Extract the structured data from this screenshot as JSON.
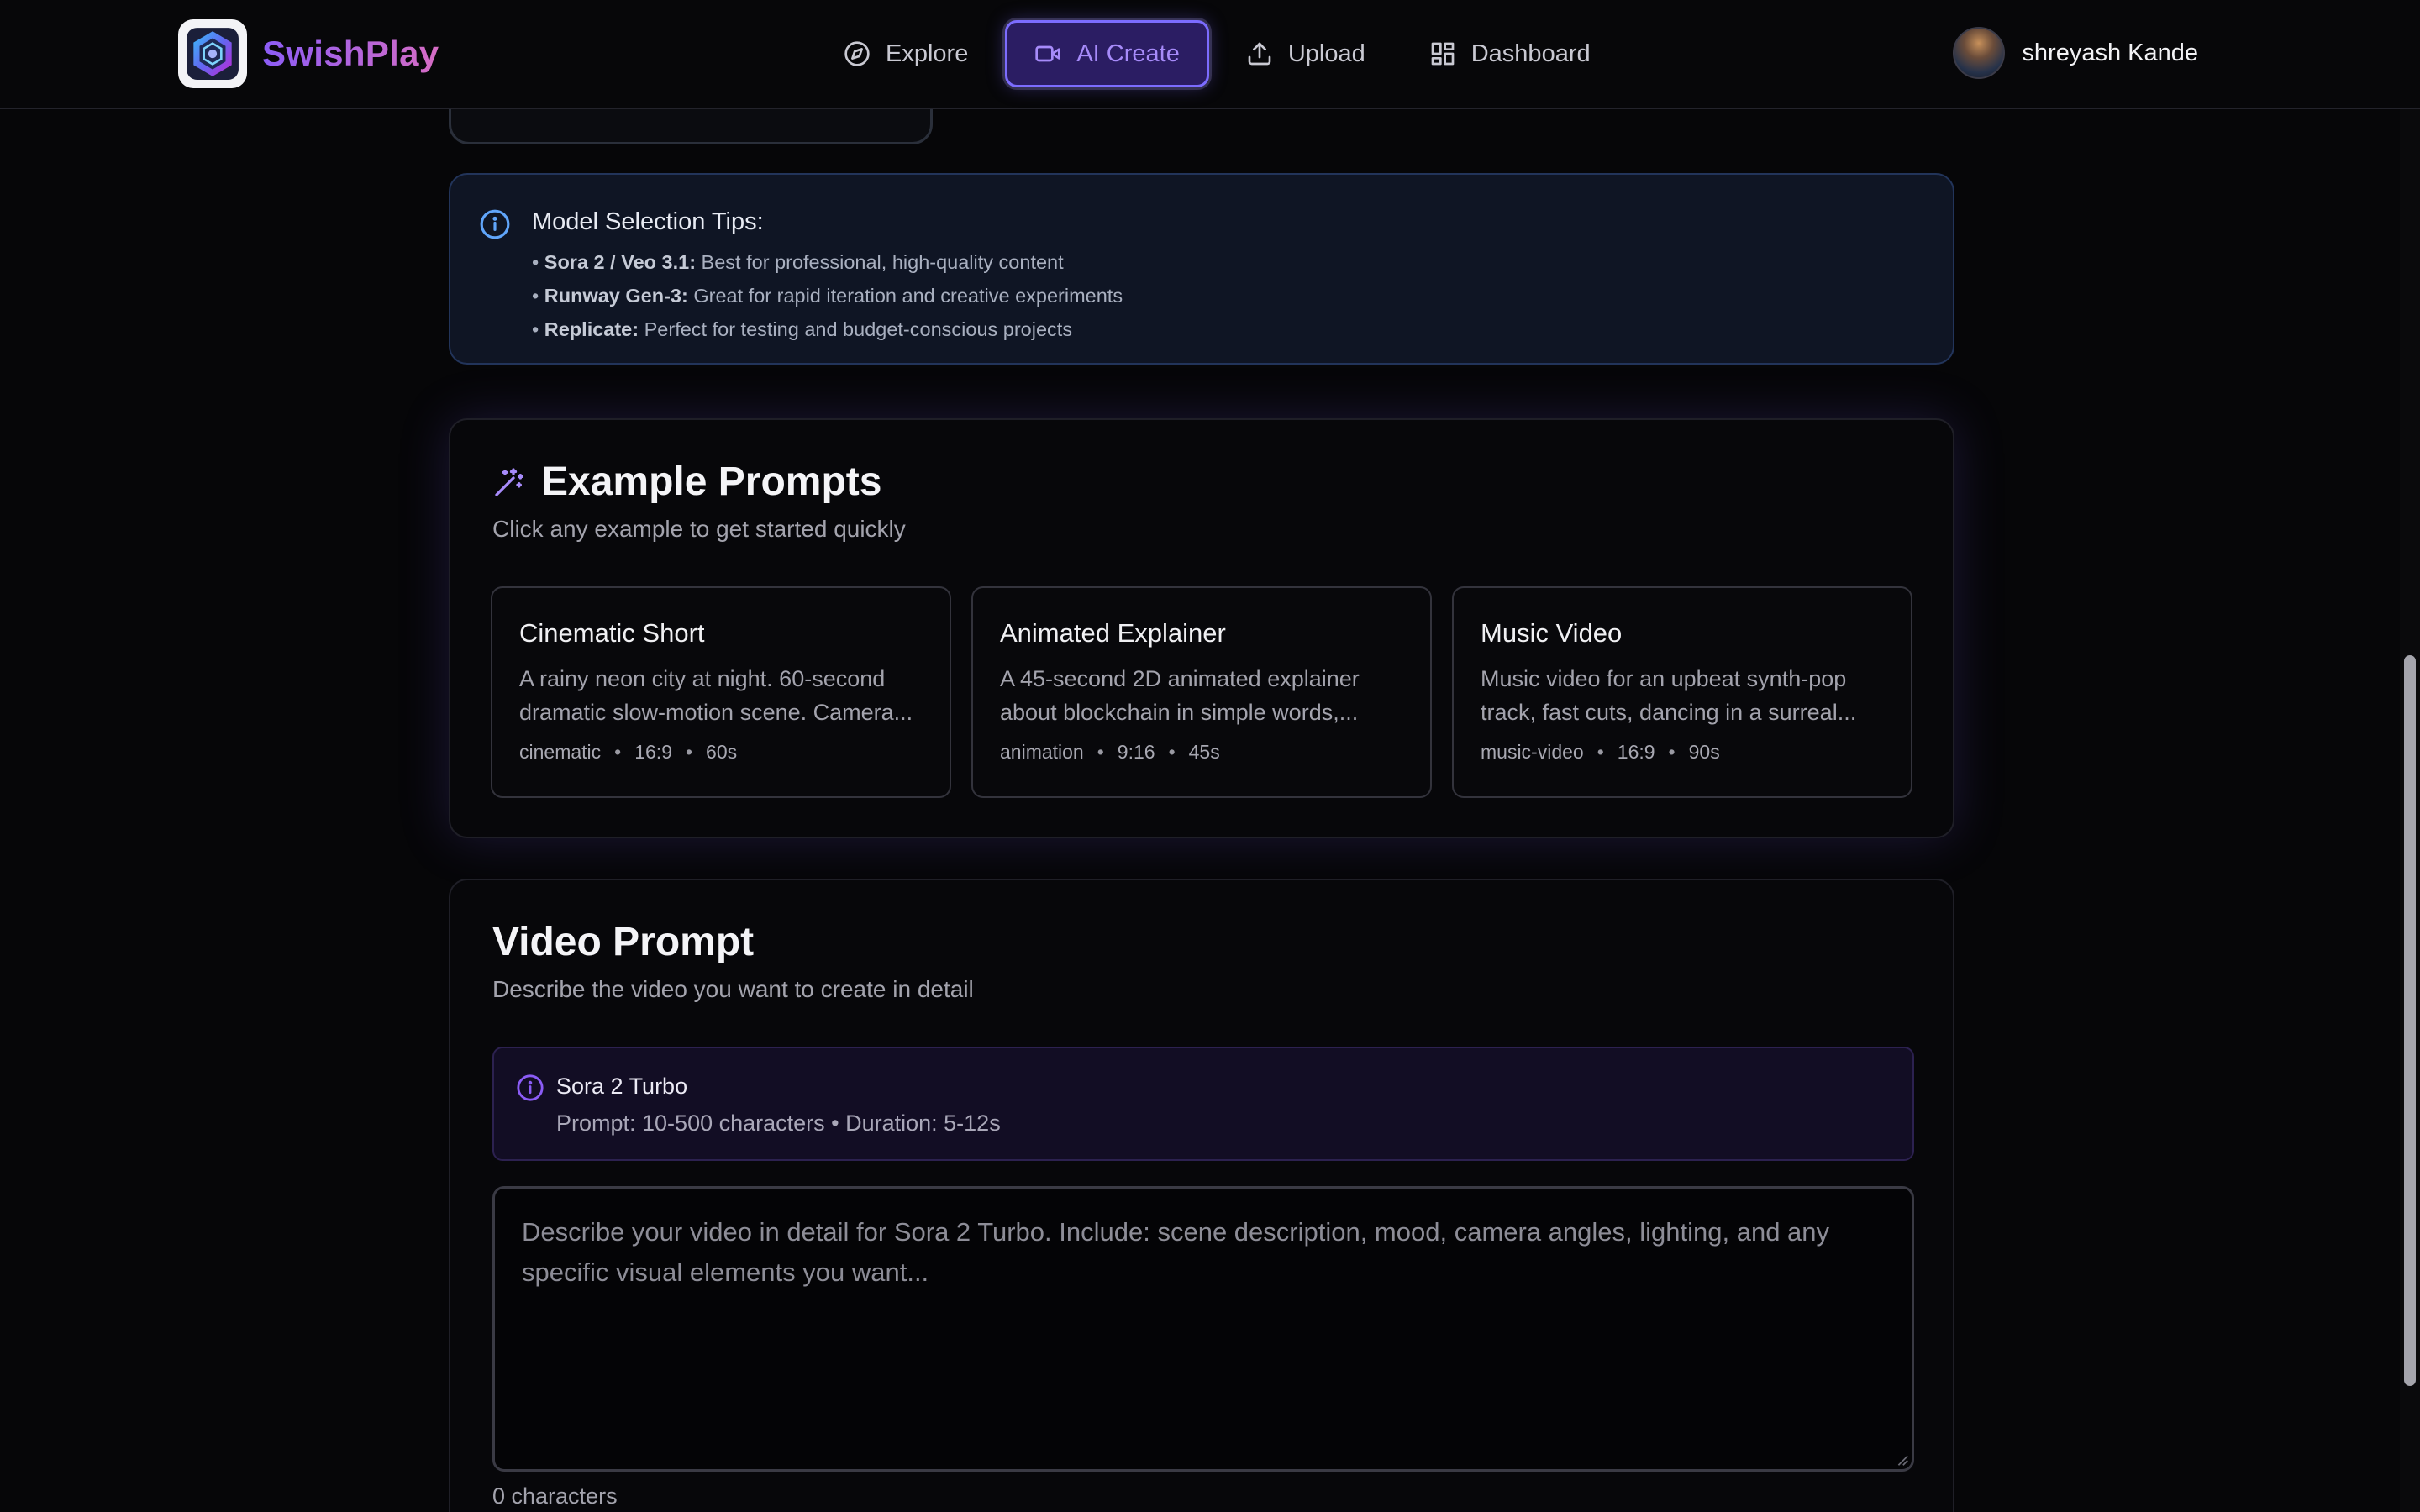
{
  "app": {
    "brand_name": "SwishPlay",
    "accent_color": "#8b5cf6"
  },
  "nav": {
    "items": [
      {
        "label": "Explore",
        "icon": "compass-icon"
      },
      {
        "label": "AI Create",
        "icon": "video-camera-icon",
        "active": true
      },
      {
        "label": "Upload",
        "icon": "upload-icon"
      },
      {
        "label": "Dashboard",
        "icon": "dashboard-grid-icon"
      }
    ]
  },
  "user": {
    "name": "shreyash Kande"
  },
  "tips": {
    "title": "Model Selection Tips:",
    "items": [
      {
        "bullet": "•",
        "bold": "Sora 2 / Veo 3.1:",
        "text": " Best for professional, high-quality content"
      },
      {
        "bullet": "•",
        "bold": "Runway Gen-3:",
        "text": " Great for rapid iteration and creative experiments"
      },
      {
        "bullet": "•",
        "bold": "Replicate:",
        "text": " Perfect for testing and budget-conscious projects"
      }
    ]
  },
  "examples": {
    "title": "Example Prompts",
    "subtitle": "Click any example to get started quickly",
    "cards": [
      {
        "title": "Cinematic Short",
        "description": "A rainy neon city at night. 60-second dramatic slow-motion scene. Camera...",
        "tags": [
          "cinematic",
          "16:9",
          "60s"
        ]
      },
      {
        "title": "Animated Explainer",
        "description": "A 45-second 2D animated explainer about blockchain in simple words,...",
        "tags": [
          "animation",
          "9:16",
          "45s"
        ]
      },
      {
        "title": "Music Video",
        "description": "Music video for an upbeat synth-pop track, fast cuts, dancing in a surreal...",
        "tags": [
          "music-video",
          "16:9",
          "90s"
        ]
      }
    ]
  },
  "video_prompt": {
    "title": "Video Prompt",
    "subtitle": "Describe the video you want to create in detail",
    "model_name": "Sora 2 Turbo",
    "model_info": "Prompt: 10-500 characters • Duration: 5-12s",
    "placeholder": "Describe your video in detail for Sora 2 Turbo. Include: scene description, mood, camera angles, lighting, and any specific visual elements you want...",
    "value": "",
    "char_count": "0 characters"
  }
}
